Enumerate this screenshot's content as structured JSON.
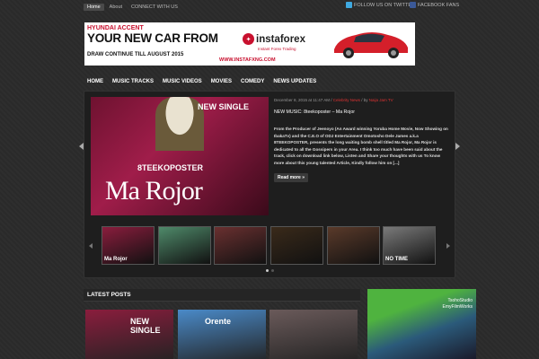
{
  "topbar": {
    "links": [
      "Home",
      "About",
      "CONNECT WITH US"
    ],
    "twitter": "FOLLOW US ON TWITTER",
    "facebook": "FACEBOOK FANS"
  },
  "banner": {
    "line1": "HYUNDAI ACCENT",
    "line2": "YOUR NEW CAR FROM",
    "brand": "instaforex",
    "tagline": "Instant Forex Trading",
    "line3": "DRAW CONTINUE TILL AUGUST 2015",
    "url": "WWW.INSTAFXNG.COM"
  },
  "nav": [
    "HOME",
    "MUSIC TRACKS",
    "MUSIC VIDEOS",
    "MOVIES",
    "COMEDY",
    "NEWS UPDATES"
  ],
  "slide": {
    "date": "December 8, 2015 at 11:47 AM / ",
    "category": "Celebrity News",
    "sep": " / by ",
    "author": "Naija Jam TV",
    "headline": "NEW MUSIC: 8teekoposter – Ma Rojor",
    "body": "From the Producer of Jeenoyo (An Award winning Yoruba Home Movie, Now Showing on IbakaTv) and the C.E.O of ODJ Entertainment Omotosho Dele James a.k.a 8TEEKOPOSTER, presents the long waiting bomb shell titled Ma Rojor, Ma Rojor is dedicated to all the Gossipers in your Area. I think too much have been said about the track, click on download link below, Listen and Share your thoughts with us To know more about this young talented Article, Kindly follow him on [...]",
    "read_more": "Read more »",
    "img_newsingle": "NEW SINGLE",
    "img_artist": "8TEEKOPOSTER",
    "img_title": "Ma Rojor"
  },
  "thumbs": [
    {
      "caption": "Ma Rojor",
      "color": "#8a1d3d"
    },
    {
      "caption": "",
      "color": "#4f8a6a"
    },
    {
      "caption": "",
      "color": "#6a3030"
    },
    {
      "caption": "",
      "color": "#3a2a1a"
    },
    {
      "caption": "",
      "color": "#5a3a2a"
    },
    {
      "caption": "NO TIME",
      "color": "#7a7a7a"
    }
  ],
  "latest": {
    "heading": "LATEST POSTS",
    "posts": [
      {
        "caption": "NEW SINGLE",
        "color": "#8a1d3d"
      },
      {
        "caption": "Orente",
        "color": "#4a8ac8"
      },
      {
        "caption": "",
        "color": "#6a5a5a"
      }
    ]
  },
  "side_ad": {
    "line1": "TsohoStudio",
    "line2": "EmyFilmWorks"
  }
}
